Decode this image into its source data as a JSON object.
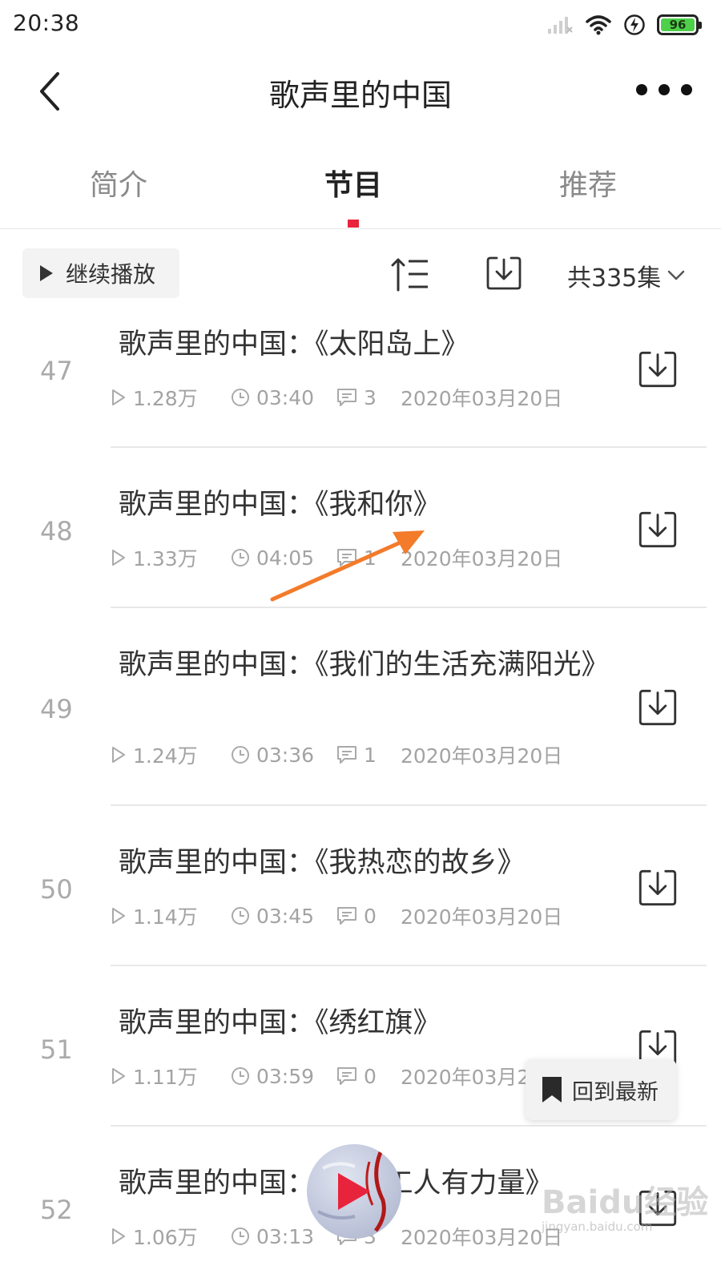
{
  "status_bar": {
    "time": "20:38",
    "battery": "96"
  },
  "header": {
    "title": "歌声里的中国"
  },
  "tabs": [
    {
      "label": "简介"
    },
    {
      "label": "节目"
    },
    {
      "label": "推荐"
    }
  ],
  "toolbar": {
    "continue_label": "继续播放",
    "count_label": "共335集"
  },
  "episodes": [
    {
      "num": "47",
      "title": "歌声里的中国：《太阳岛上》",
      "plays": "1.28万",
      "duration": "03:40",
      "comments": "3",
      "date": "2020年03月20日"
    },
    {
      "num": "48",
      "title": "歌声里的中国：《我和你》",
      "plays": "1.33万",
      "duration": "04:05",
      "comments": "1",
      "date": "2020年03月20日"
    },
    {
      "num": "49",
      "title": "歌声里的中国：《我们的生活充满阳光》",
      "plays": "1.24万",
      "duration": "03:36",
      "comments": "1",
      "date": "2020年03月20日"
    },
    {
      "num": "50",
      "title": "歌声里的中国：《我热恋的故乡》",
      "plays": "1.14万",
      "duration": "03:45",
      "comments": "0",
      "date": "2020年03月20日"
    },
    {
      "num": "51",
      "title": "歌声里的中国：《绣红旗》",
      "plays": "1.11万",
      "duration": "03:59",
      "comments": "0",
      "date": "2020年03月20日"
    },
    {
      "num": "52",
      "title": "歌声里的中国：《咱们工人有力量》",
      "plays": "1.06万",
      "duration": "03:13",
      "comments": "3",
      "date": "2020年03月20日"
    }
  ],
  "floating": {
    "latest_label": "回到最新"
  },
  "watermark": {
    "brand": "Baidu经验",
    "url": "jingyan.baidu.com"
  },
  "colors": {
    "accent": "#e8243c",
    "annotation": "#f37b2a",
    "battery": "#4ed04a"
  }
}
